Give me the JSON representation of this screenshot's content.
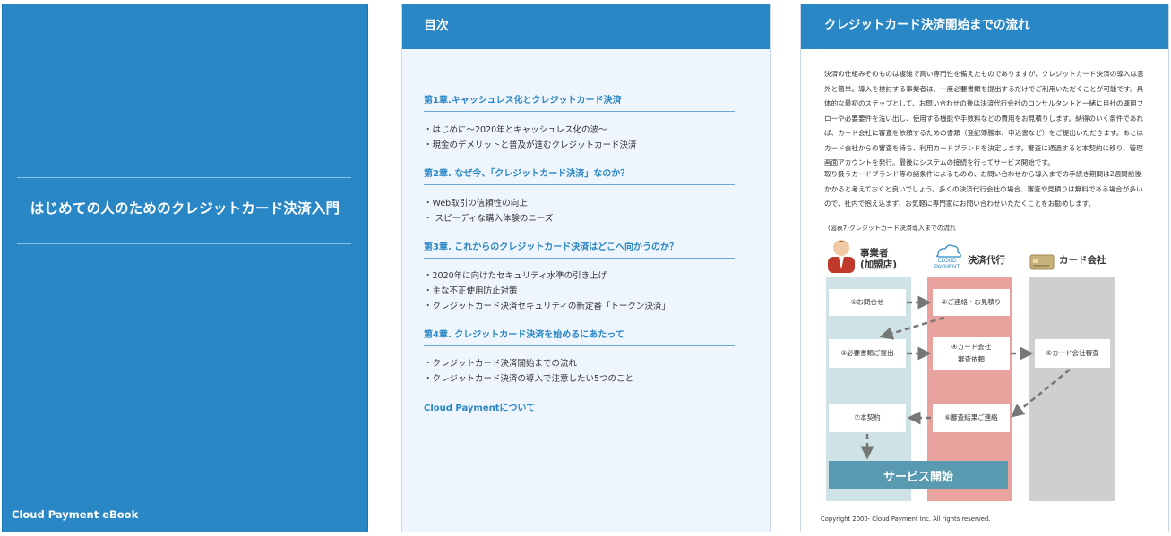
{
  "cover": {
    "title": "はじめての人のためのクレジットカード決済入門",
    "footer": "Cloud Payment eBook"
  },
  "toc": {
    "header": "目次",
    "chapters": [
      {
        "title": "第1章.キャッシュレス化とクレジットカード決済",
        "items": [
          "・はじめに～2020年とキャッシュレス化の波～",
          "・現金のデメリットと普及が進むクレジットカード決済"
        ]
      },
      {
        "title": "第2章. なぜ今、「クレジットカード決済」なのか？",
        "items": [
          "・Web取引の信頼性の向上",
          "・ スピーディな購入体験のニーズ"
        ]
      },
      {
        "title": "第3章. これからのクレジットカード決済はどこへ向かうのか？",
        "items": [
          "・2020年に向けたセキュリティ水準の引き上げ",
          "・主な不正使用防止対策",
          "・クレジットカード決済セキュリティの新定番「トークン決済」"
        ]
      },
      {
        "title": "第4章. クレジットカード決済を始めるにあたって",
        "items": [
          "・クレジットカード決済開始までの流れ",
          "・クレジットカード決済の導入で注意したい5つのこと"
        ]
      }
    ],
    "about": "Cloud Paymentについて"
  },
  "flow": {
    "header": "クレジットカード決済開始までの流れ",
    "para1": "決済の仕組みそのものは複雑で高い専門性を備えたものでありますが、クレジットカード決済の導入は意外と簡単。導入を検討する事業者は、一度必要書類を提出するだけでご利用いただくことが可能です。具体的な最初のステップとして、お問い合わせの後は決済代行会社のコンサルタントと一緒に自社の運用フローや必要要件を洗い出し、使用する機能や手数料などの費用をお見積りします。納得のいく条件であれば、カード会社に審査を依頼するための書類（登記簿謄本、申込書など）をご提出いただきます。あとはカード会社からの審査を待ち、利用カードブランドを決定します。審査に通過すると本契約に移り、管理画面アカウントを発行。最後にシステムの接続を行ってサービス開始です。",
    "para2": "取り扱うカードブランド等の諸条件によるものの、お問い合わせから導入までの手続き期間は2週間前後かかると考えておくと良いでしょう。多くの決済代行会社の場合、審査や見積りは無料である場合が多いので、社内で抱え込まず、お気軽に専門家にお問い合わせいただくことをお勧めします。",
    "caption": "(図表7)クレジットカード決済導入までの流れ",
    "lanes": {
      "merchant": "事業者\n(加盟店)",
      "agent": "決済代行",
      "card": "カード会社",
      "cloud_logo_top": "CLOUD",
      "cloud_logo_bottom": "PAYMENT"
    },
    "steps": {
      "s1": "①お問合せ",
      "s2": "②ご連絡・お見積り",
      "s3": "③必要書類ご提出",
      "s4a": "④カード会社",
      "s4b": "審査依頼",
      "s5": "⑤カード会社審査",
      "s6": "⑥審査結果ご連絡",
      "s7": "⑦本契約"
    },
    "service": "サービス開始",
    "copyright": "Copyright 2000- Cloud Payment Inc. All rights reserved.",
    "colors": {
      "blue": "#2a87c5",
      "merchant_lane": "#cfe3e6",
      "agent_lane": "#e9a39f",
      "card_lane": "#cfcfcf",
      "service": "#5a9ab0"
    }
  }
}
